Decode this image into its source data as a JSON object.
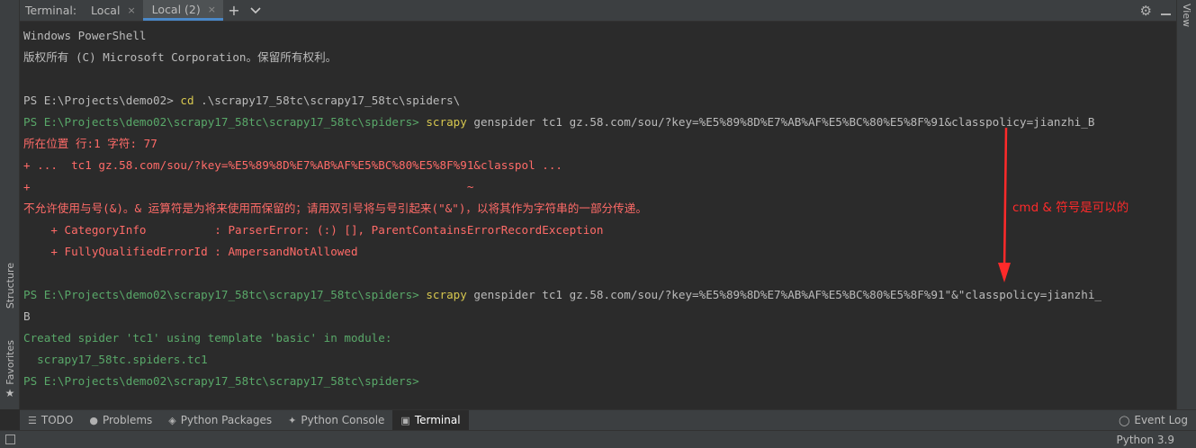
{
  "header": {
    "title": "Terminal:",
    "tabs": [
      {
        "label": "Local",
        "closable": true,
        "active": false
      },
      {
        "label": "Local (2)",
        "closable": true,
        "active": true
      }
    ],
    "close_glyph": "×",
    "add_glyph": "+",
    "dropdown_glyph": "⌄",
    "gear_glyph": "⚙"
  },
  "right_strip": {
    "label": "View"
  },
  "left_strip": {
    "structure_label": "Structure",
    "favorites_label": "Favorites",
    "favorites_star": "★"
  },
  "terminal": {
    "lines": [
      {
        "segments": [
          {
            "text": "Windows PowerShell",
            "color": "white"
          }
        ]
      },
      {
        "segments": [
          {
            "text": "版权所有 (C) Microsoft Corporation。保留所有权利。",
            "color": "white"
          }
        ]
      },
      {
        "segments": [
          {
            "text": "",
            "color": "white"
          }
        ]
      },
      {
        "segments": [
          {
            "text": "PS E:\\Projects\\demo02> ",
            "color": "white"
          },
          {
            "text": "cd",
            "color": "yellow"
          },
          {
            "text": " .\\scrapy17_58tc\\scrapy17_58tc\\spiders\\",
            "color": "white"
          }
        ]
      },
      {
        "segments": [
          {
            "text": "PS E:\\Projects\\demo02\\scrapy17_58tc\\scrapy17_58tc\\spiders> ",
            "color": "green"
          },
          {
            "text": "scrapy",
            "color": "yellow"
          },
          {
            "text": " genspider tc1 gz.58.com/sou/?key=%E5%89%8D%E7%AB%AF%E5%BC%80%E5%8F%91&classpolicy=jianzhi_B",
            "color": "white"
          }
        ]
      },
      {
        "segments": [
          {
            "text": "所在位置 行:1 字符: 77",
            "color": "red"
          }
        ]
      },
      {
        "segments": [
          {
            "text": "+ ...  tc1 gz.58.com/sou/?key=%E5%89%8D%E7%AB%AF%E5%BC%80%E5%8F%91&classpol ...",
            "color": "red"
          }
        ]
      },
      {
        "segments": [
          {
            "text": "+                                                                ~",
            "color": "red"
          }
        ]
      },
      {
        "segments": [
          {
            "text": "不允许使用与号(&)。& 运算符是为将来使用而保留的；请用双引号将与号引起来(\"&\")，以将其作为字符串的一部分传递。",
            "color": "red"
          }
        ]
      },
      {
        "segments": [
          {
            "text": "    + CategoryInfo          : ParserError: (:) [], ParentContainsErrorRecordException",
            "color": "red"
          }
        ]
      },
      {
        "segments": [
          {
            "text": "    + FullyQualifiedErrorId : AmpersandNotAllowed",
            "color": "red"
          }
        ]
      },
      {
        "segments": [
          {
            "text": "",
            "color": "white"
          }
        ]
      },
      {
        "segments": [
          {
            "text": "PS E:\\Projects\\demo02\\scrapy17_58tc\\scrapy17_58tc\\spiders> ",
            "color": "green"
          },
          {
            "text": "scrapy",
            "color": "yellow"
          },
          {
            "text": " genspider tc1 gz.58.com/sou/?key=%E5%89%8D%E7%AB%AF%E5%BC%80%E5%8F%91\"&\"classpolicy=jianzhi_",
            "color": "white"
          }
        ]
      },
      {
        "segments": [
          {
            "text": "B",
            "color": "white"
          }
        ]
      },
      {
        "segments": [
          {
            "text": "Created spider 'tc1' using template 'basic' in module:",
            "color": "green"
          }
        ]
      },
      {
        "segments": [
          {
            "text": "  scrapy17_58tc.spiders.tc1",
            "color": "green"
          }
        ]
      },
      {
        "segments": [
          {
            "text": "PS E:\\Projects\\demo02\\scrapy17_58tc\\scrapy17_58tc\\spiders> ",
            "color": "green"
          }
        ]
      }
    ]
  },
  "annotation": {
    "text": "cmd & 符号是可以的",
    "color": "#ff2a2a"
  },
  "bottom_bar": {
    "tabs": [
      {
        "label": "TODO",
        "icon": "list-icon",
        "glyph": "☰",
        "active": false
      },
      {
        "label": "Problems",
        "icon": "problems-icon",
        "glyph": "●",
        "active": false
      },
      {
        "label": "Python Packages",
        "icon": "packages-icon",
        "glyph": "◈",
        "active": false
      },
      {
        "label": "Python Console",
        "icon": "python-console-icon",
        "glyph": "✦",
        "active": false
      },
      {
        "label": "Terminal",
        "icon": "terminal-icon",
        "glyph": "▣",
        "active": true
      }
    ],
    "event_log": {
      "label": "Event Log",
      "icon": "event-log-icon",
      "glyph": "◯"
    }
  },
  "status_bar": {
    "interpreter": "Python 3.9"
  },
  "colors": {
    "white": "#bbbbbb",
    "green": "#59a869",
    "red": "#ff6b68",
    "yellow": "#d7c74f",
    "accent": "#4a88c7",
    "background": "#2b2b2b",
    "panel": "#3c3f41"
  }
}
